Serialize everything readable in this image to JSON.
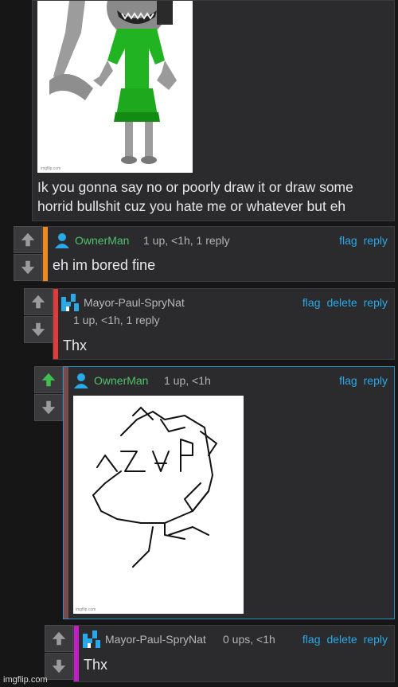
{
  "post": {
    "text_line1": "Ik you gonna say no or poorly draw it or draw some",
    "text_line2": "horrid bullshit cuz you hate me or whatever but eh",
    "image_watermark": "imgflip.com"
  },
  "comments": [
    {
      "username": "OwnerMan",
      "meta": "1 up, <1h, 1 reply",
      "actions": [
        "flag",
        "reply"
      ],
      "text": "eh im bored fine",
      "bar_color": "#f08a1c",
      "upvoted": false
    },
    {
      "username": "Mayor-Paul-SpryNat",
      "meta": "1 up, <1h, 1 reply",
      "actions": [
        "flag",
        "delete",
        "reply"
      ],
      "text": "Thx",
      "bar_color": "#e23b3b",
      "upvoted": false
    },
    {
      "username": "OwnerMan",
      "meta": "1 up, <1h",
      "actions": [
        "flag",
        "reply"
      ],
      "text": "",
      "bar_color": "#7a4a4a",
      "upvoted": true,
      "image_watermark": "imgflip.com"
    },
    {
      "username": "Mayor-Paul-SpryNat",
      "meta": "0 ups, <1h",
      "actions": [
        "flag",
        "delete",
        "reply"
      ],
      "text": "Thx",
      "bar_color": "#c21fc9",
      "upvoted": false
    }
  ],
  "footer": {
    "watermark": "imgflip.com"
  },
  "colors": {
    "accent_link": "#29a9e8",
    "upvote_active": "#3fbf4f",
    "username_green": "#4fc26d"
  }
}
